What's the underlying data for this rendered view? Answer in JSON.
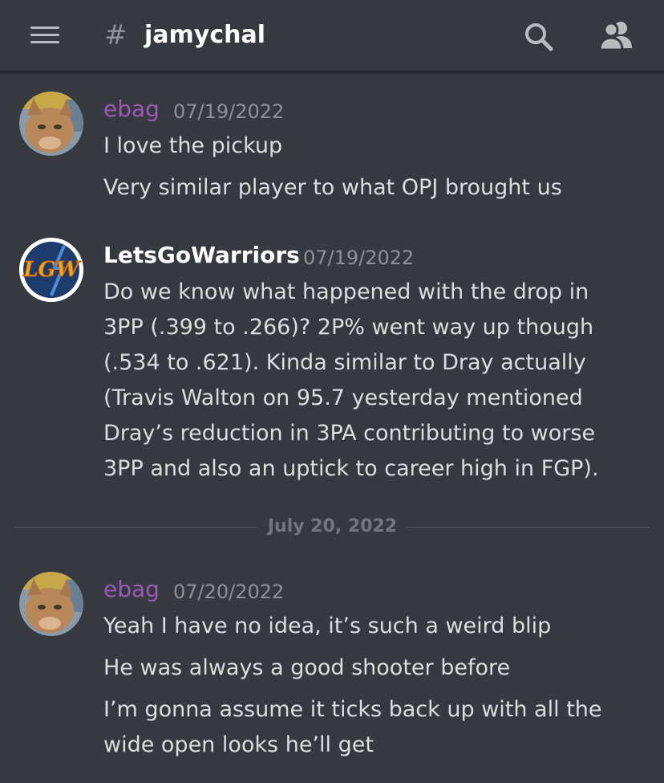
{
  "header": {
    "channel_prefix": "#",
    "channel_name": "jamychal"
  },
  "colors": {
    "background": "#36393f",
    "ebag_name": "#9b59b6",
    "lgw_name": "#ffffff",
    "timestamp": "#8e9297",
    "text": "#dcddde"
  },
  "icons": {
    "menu": "hamburger-menu-icon",
    "search": "search-icon",
    "members": "members-icon"
  },
  "messages": [
    {
      "author": "ebag",
      "timestamp": "07/19/2022",
      "avatar": "cat-avatar",
      "lines": [
        "I love the pickup",
        "Very similar player to what OPJ brought us"
      ]
    },
    {
      "author": "LetsGoWarriors",
      "timestamp": "07/19/2022",
      "avatar": "lgw-logo-avatar",
      "avatar_text": "LGW",
      "lines": [
        "Do we know what happened with the drop in",
        "3PP (.399 to .266)? 2P% went way up though",
        "(.534 to .621). Kinda similar to Dray actually",
        "(Travis Walton on 95.7 yesterday mentioned",
        "Dray’s reduction in 3PA contributing to worse",
        "3PP and also an uptick to career high in FGP)."
      ]
    },
    {
      "author": "ebag",
      "timestamp": "07/20/2022",
      "avatar": "cat-avatar",
      "lines": [
        "Yeah I have no idea, it’s such a weird blip",
        "He was always a good shooter before",
        "I’m gonna assume it ticks back up with all the",
        "wide open looks he’ll get"
      ]
    }
  ],
  "date_divider": "July 20, 2022"
}
